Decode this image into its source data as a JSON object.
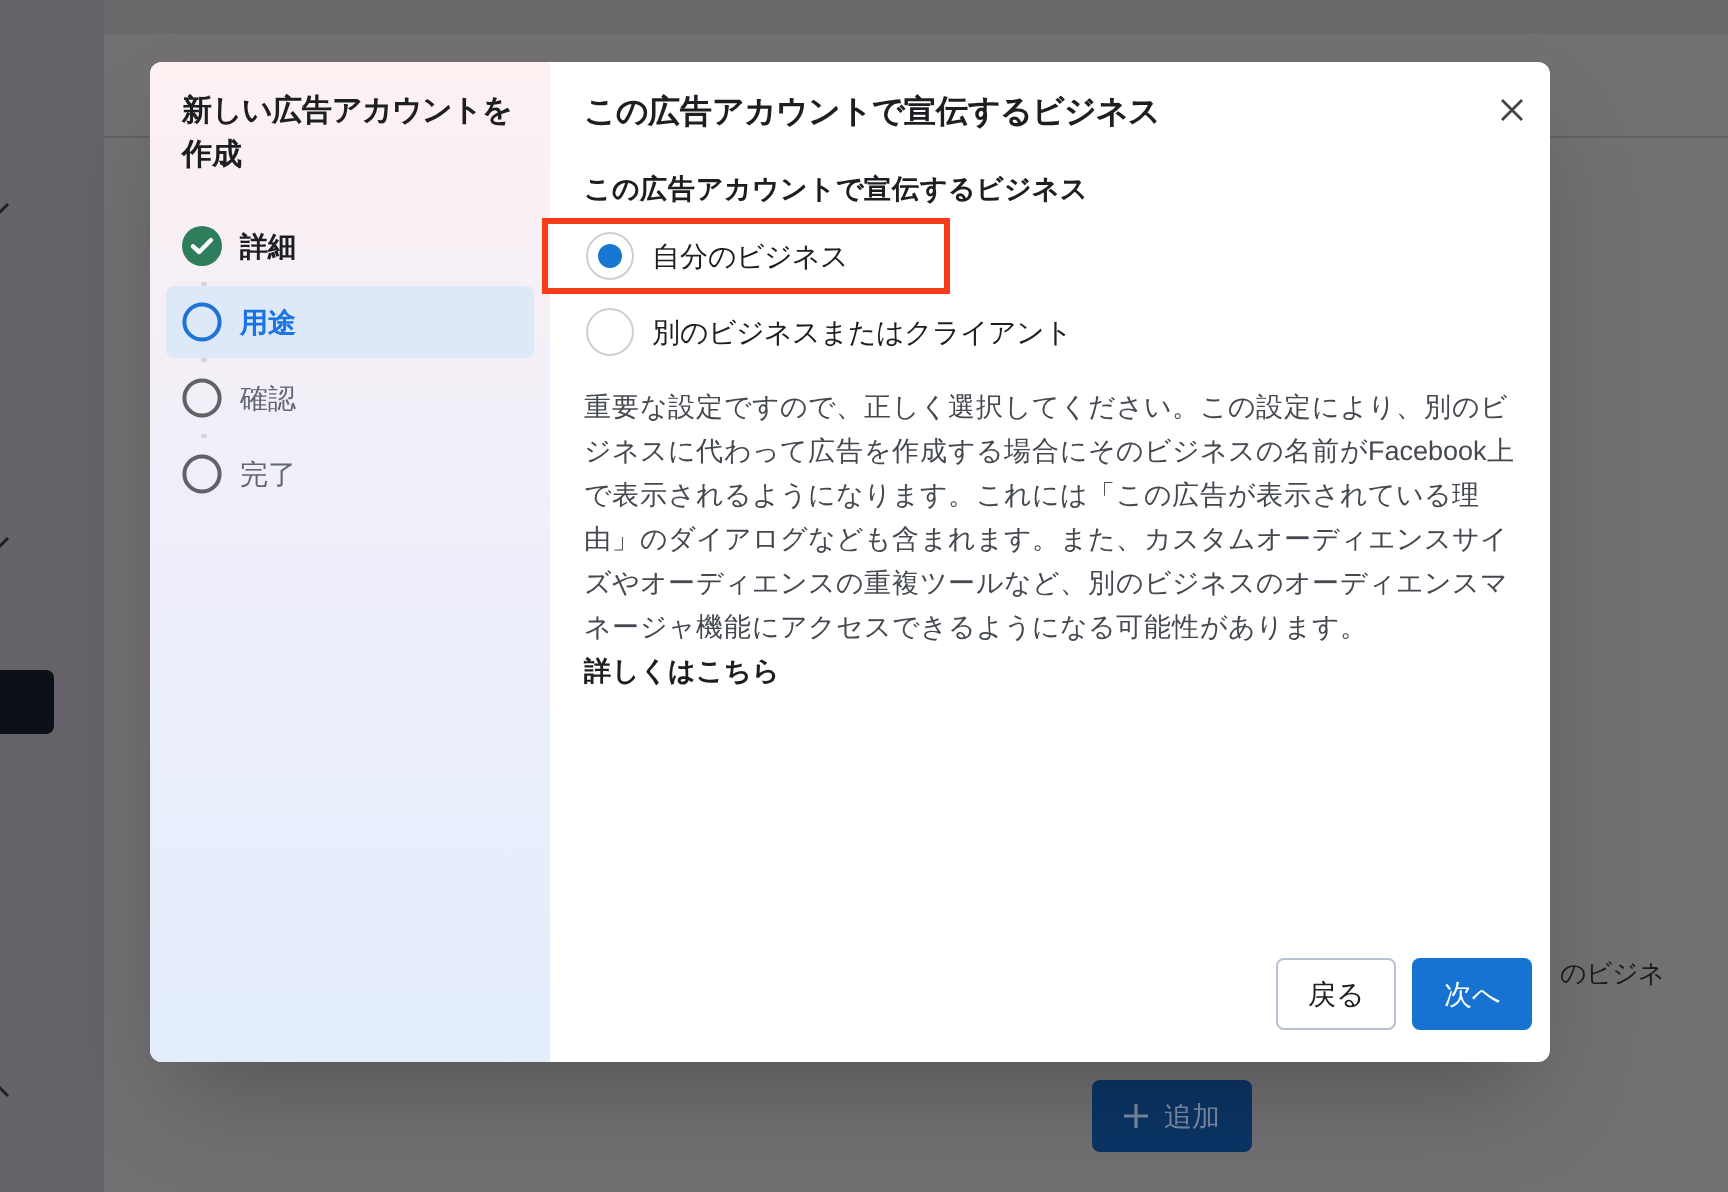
{
  "background": {
    "text_fragment": "のビジネ",
    "add_button": "追加"
  },
  "dialog": {
    "sidebar_title": "新しい広告アカウントを作成",
    "steps": [
      {
        "label": "詳細",
        "kind": "done",
        "selected": false
      },
      {
        "label": "用途",
        "kind": "current",
        "selected": true
      },
      {
        "label": "確認",
        "kind": "pending",
        "selected": false
      },
      {
        "label": "完了",
        "kind": "pending",
        "selected": false
      }
    ],
    "title": "この広告アカウントで宣伝するビジネス",
    "question": "この広告アカウントで宣伝するビジネス",
    "options": [
      {
        "label": "自分のビジネス",
        "selected": true,
        "highlighted": true
      },
      {
        "label": "別のビジネスまたはクライアント",
        "selected": false,
        "highlighted": false
      }
    ],
    "description": "重要な設定ですので、正しく選択してください。この設定により、別のビジネスに代わって広告を作成する場合にそのビジネスの名前がFacebook上で表示されるようになります。これには「この広告が表示されている理由」のダイアログなども含まれます。また、カスタムオーディエンスサイズやオーディエンスの重複ツールなど、別のビジネスのオーディエンスマネージャ機能にアクセスできるようになる可能性があります。",
    "link": "詳しくはこちら",
    "back_button": "戻る",
    "next_button": "次へ"
  }
}
